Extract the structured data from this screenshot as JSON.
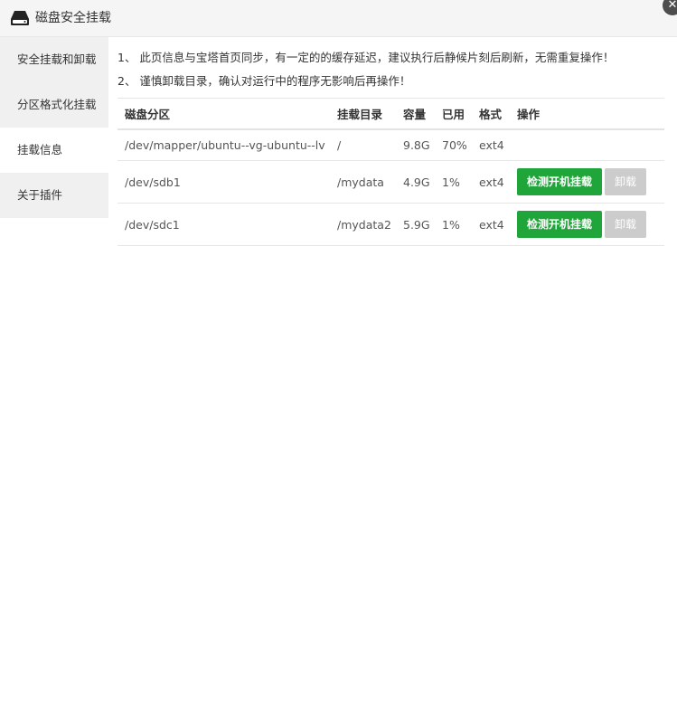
{
  "window": {
    "title": "磁盘安全挂载",
    "close_glyph": "✕"
  },
  "sidebar": {
    "items": [
      {
        "label": "安全挂载和卸载",
        "active": false
      },
      {
        "label": "分区格式化挂载",
        "active": false
      },
      {
        "label": "挂载信息",
        "active": true
      },
      {
        "label": "关于插件",
        "active": false
      }
    ]
  },
  "notices": [
    "1、 此页信息与宝塔首页同步，有一定的的缓存延迟，建议执行后静候片刻后刷新，无需重复操作！",
    "2、 谨慎卸载目录，确认对运行中的程序无影响后再操作！"
  ],
  "table": {
    "headers": [
      "磁盘分区",
      "挂载目录",
      "容量",
      "已用",
      "格式",
      "操作"
    ],
    "rows": [
      {
        "partition": "/dev/mapper/ubuntu--vg-ubuntu--lv",
        "mount": "/",
        "size": "9.8G",
        "used": "70%",
        "format": "ext4",
        "actions": []
      },
      {
        "partition": "/dev/sdb1",
        "mount": "/mydata",
        "size": "4.9G",
        "used": "1%",
        "format": "ext4",
        "actions": [
          "检测开机挂载",
          "卸载"
        ]
      },
      {
        "partition": "/dev/sdc1",
        "mount": "/mydata2",
        "size": "5.9G",
        "used": "1%",
        "format": "ext4",
        "actions": [
          "检测开机挂载",
          "卸载"
        ]
      }
    ]
  },
  "colors": {
    "primary_button": "#20a53a",
    "disabled_button": "#cccccc"
  },
  "icons": {
    "title": "disk-icon",
    "close": "close-icon"
  }
}
